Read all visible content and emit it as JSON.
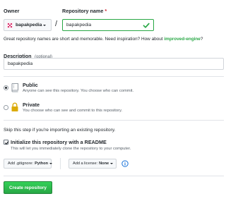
{
  "owner": {
    "label": "Owner",
    "value": "bapakpedia",
    "avatar_color": "#d6336c",
    "icon": "chevron-down-icon"
  },
  "separator": "/",
  "repo_name": {
    "label": "Repository name",
    "required_mark": "*",
    "value": "bapakpedia",
    "valid_icon": "check-icon",
    "valid_color": "#28a745"
  },
  "suggestion": {
    "text": "Great repository names are short and memorable. Need inspiration? How about",
    "name": "improved-engine",
    "suffix": "?",
    "name_color": "#28a745"
  },
  "description": {
    "label": "Description",
    "optional": "(optional)",
    "value": "bapakpedia"
  },
  "visibility": {
    "public": {
      "title": "Public",
      "desc": "Anyone can see this repository. You choose who can commit.",
      "selected": true,
      "icon": "repo-icon"
    },
    "private": {
      "title": "Private",
      "desc": "You choose who can see and commit to this repository.",
      "selected": false,
      "icon": "lock-icon",
      "icon_color": "#dbab09"
    }
  },
  "skip_note": "Skip this step if you're importing an existing repository.",
  "init_readme": {
    "checked": true,
    "title": "Initialize this repository with a README",
    "desc": "This will let you immediately clone the repository to your computer."
  },
  "gitignore": {
    "prefix": "Add .gitignore:",
    "value": "Python"
  },
  "license": {
    "prefix": "Add a license:",
    "value": "None"
  },
  "info_icon": "info-icon",
  "create_button": {
    "label": "Create repository",
    "color": "#28a745"
  }
}
